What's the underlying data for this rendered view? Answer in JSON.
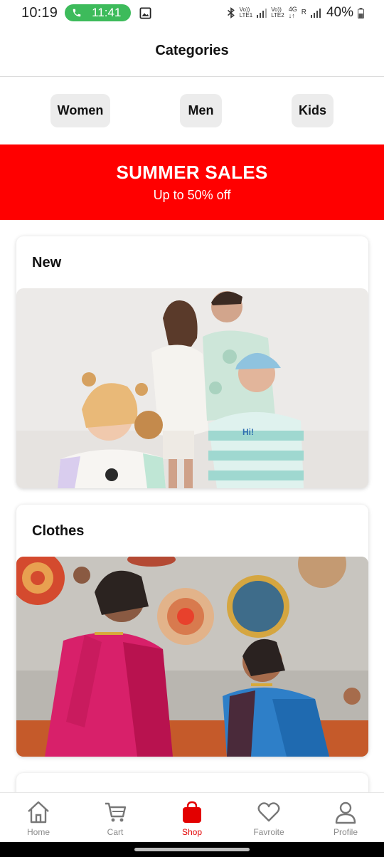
{
  "status_bar": {
    "time": "10:19",
    "call_timer": "11:41",
    "sim1_tag_top": "Vo))",
    "sim1_tag_bottom": "LTE1",
    "sim2_tag_top": "Vo))",
    "sim2_tag_bottom": "LTE2",
    "net_type": "4G",
    "roaming": "R",
    "battery": "40%"
  },
  "header": {
    "title": "Categories"
  },
  "chips": [
    {
      "label": "Women"
    },
    {
      "label": "Men"
    },
    {
      "label": "Kids"
    }
  ],
  "banner": {
    "title": "SUMMER SALES",
    "subtitle": "Up to 50% off",
    "color": "#ff0000"
  },
  "cards": [
    {
      "title": "New",
      "image": "family-kids-fashion-photo"
    },
    {
      "title": "Clothes",
      "image": "women-in-sarees-photo"
    },
    {
      "title": ""
    }
  ],
  "bottom_nav": {
    "active": "Shop",
    "accent": "#e30000",
    "items": [
      {
        "label": "Home",
        "icon": "home-icon"
      },
      {
        "label": "Cart",
        "icon": "cart-icon"
      },
      {
        "label": "Shop",
        "icon": "shopping-bag-icon"
      },
      {
        "label": "Favroite",
        "icon": "heart-icon"
      },
      {
        "label": "Profile",
        "icon": "profile-icon"
      }
    ]
  }
}
